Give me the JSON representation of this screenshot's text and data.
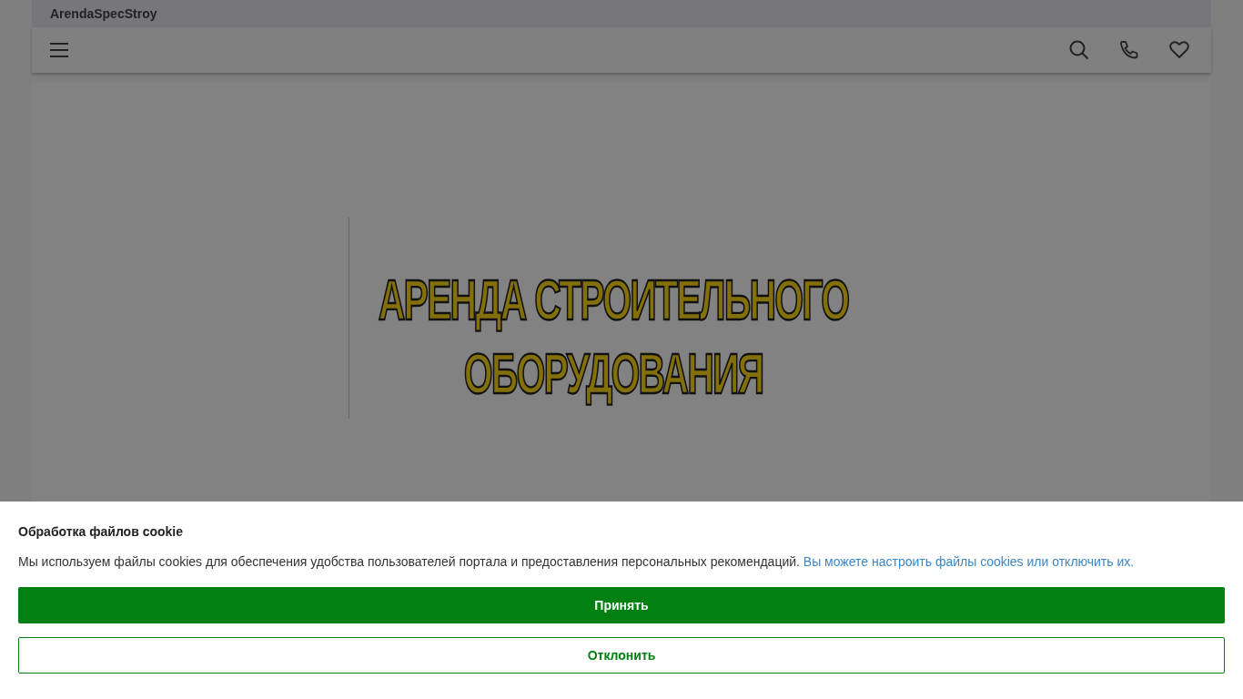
{
  "site_name": "ArendaSpecStroy",
  "banner": {
    "heading": "АРЕНДА СТРОИТЕЛЬНОГО ОБОРУДОВАНИЯ"
  },
  "cookie": {
    "title": "Обработка файлов cookie",
    "text": "Мы используем файлы cookies для обеспечения удобства пользователей портала и предоставления персональных рекомендаций.",
    "link": "Вы можете настроить файлы cookies или отключить их.",
    "buttons": [
      {
        "label": "Принять",
        "kind": "primary"
      },
      {
        "label": "Отклонить",
        "kind": "secondary"
      }
    ]
  }
}
